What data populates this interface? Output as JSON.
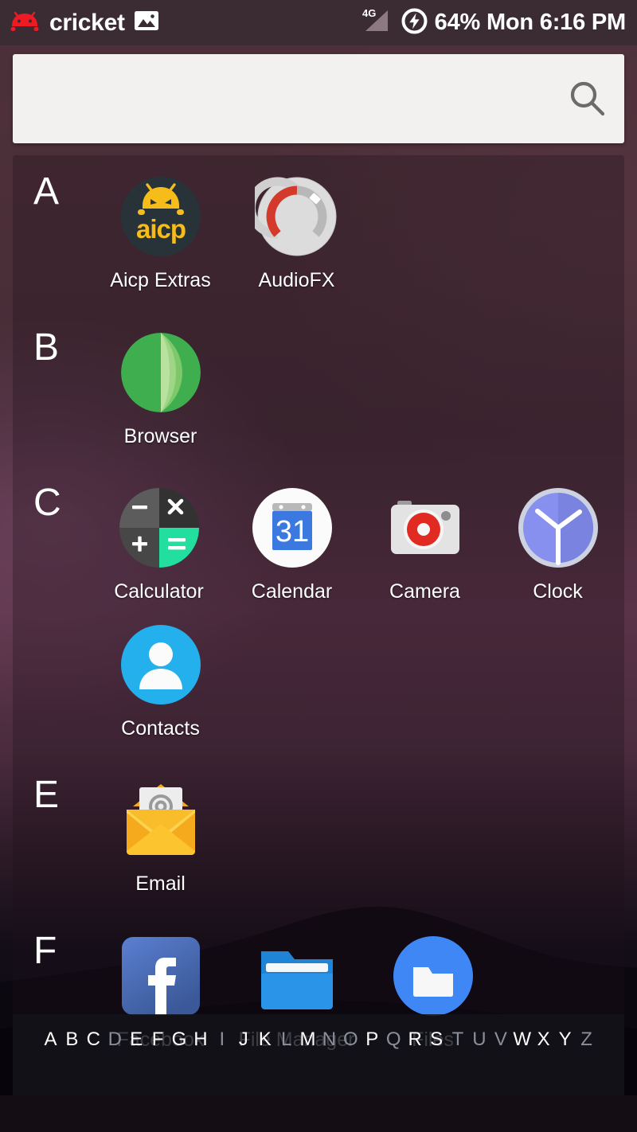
{
  "status_bar": {
    "carrier_icon": "android-head-icon",
    "carrier": "cricket",
    "screenshot_icon": "image-icon",
    "network_label": "4G",
    "signal_icon": "signal-triangle-icon",
    "battery_icon": "battery-charging-icon",
    "battery_percent": "64%",
    "day": "Mon",
    "time": "6:16 PM",
    "clock_text": "64% Mon 6:16 PM",
    "colors": {
      "background": "#3b2b32",
      "carrier_logo": "#ee1b24",
      "text": "#ffffff"
    }
  },
  "search": {
    "value": "",
    "placeholder": "",
    "icon": "search-icon",
    "background": "#f2f1f0"
  },
  "drawer": {
    "sections": [
      {
        "letter": "A",
        "apps": [
          {
            "label": "Aicp Extras",
            "icon": "aicp-extras-icon"
          },
          {
            "label": "AudioFX",
            "icon": "audiofx-icon"
          }
        ]
      },
      {
        "letter": "B",
        "apps": [
          {
            "label": "Browser",
            "icon": "browser-icon"
          }
        ]
      },
      {
        "letter": "C",
        "apps": [
          {
            "label": "Calculator",
            "icon": "calculator-icon"
          },
          {
            "label": "Calendar",
            "icon": "calendar-icon"
          },
          {
            "label": "Camera",
            "icon": "camera-icon"
          },
          {
            "label": "Clock",
            "icon": "clock-icon"
          },
          {
            "label": "Contacts",
            "icon": "contacts-icon"
          }
        ]
      },
      {
        "letter": "E",
        "apps": [
          {
            "label": "Email",
            "icon": "email-icon"
          }
        ]
      },
      {
        "letter": "F",
        "apps": [
          {
            "label": "Facebook",
            "icon": "facebook-icon"
          },
          {
            "label": "File Manager",
            "icon": "file-manager-icon"
          },
          {
            "label": "Files",
            "icon": "files-icon"
          }
        ]
      }
    ]
  },
  "alphabet_index": {
    "letters": [
      {
        "char": "A",
        "active": true
      },
      {
        "char": "B",
        "active": true
      },
      {
        "char": "C",
        "active": true
      },
      {
        "char": "D",
        "active": false
      },
      {
        "char": "E",
        "active": true
      },
      {
        "char": "F",
        "active": true
      },
      {
        "char": "G",
        "active": true
      },
      {
        "char": "H",
        "active": true
      },
      {
        "char": "I",
        "active": false
      },
      {
        "char": "J",
        "active": true
      },
      {
        "char": "K",
        "active": true
      },
      {
        "char": "L",
        "active": false
      },
      {
        "char": "M",
        "active": true
      },
      {
        "char": "N",
        "active": false
      },
      {
        "char": "O",
        "active": false
      },
      {
        "char": "P",
        "active": true
      },
      {
        "char": "Q",
        "active": false
      },
      {
        "char": "R",
        "active": true
      },
      {
        "char": "S",
        "active": true
      },
      {
        "char": "T",
        "active": false
      },
      {
        "char": "U",
        "active": false
      },
      {
        "char": "V",
        "active": false
      },
      {
        "char": "W",
        "active": true
      },
      {
        "char": "X",
        "active": true
      },
      {
        "char": "Y",
        "active": true
      },
      {
        "char": "Z",
        "active": false
      }
    ]
  }
}
